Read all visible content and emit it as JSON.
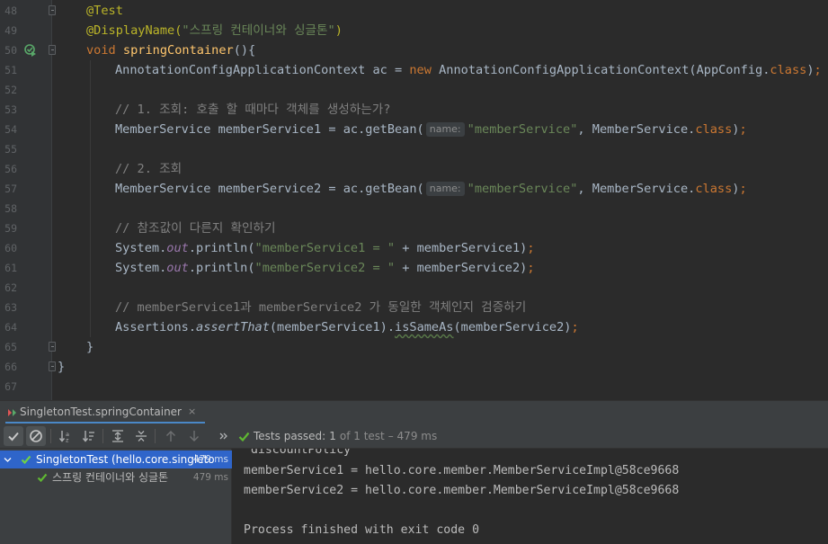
{
  "editor": {
    "lines": [
      {
        "n": "48",
        "tokens": [
          {
            "t": "@Test",
            "c": "ann"
          }
        ]
      },
      {
        "n": "49",
        "tokens": [
          {
            "t": "@DisplayName(",
            "c": "ann"
          },
          {
            "t": "\"스프링 컨테이너와 싱글톤\"",
            "c": "str"
          },
          {
            "t": ")",
            "c": "ann"
          }
        ]
      },
      {
        "n": "50",
        "tokens": [
          {
            "t": "void ",
            "c": "kw"
          },
          {
            "t": "springContainer",
            "c": "fn"
          },
          {
            "t": "(){",
            "c": ""
          }
        ]
      },
      {
        "n": "51",
        "tokens": [
          {
            "t": "AnnotationConfigApplicationContext ac = ",
            "c": ""
          },
          {
            "t": "new ",
            "c": "kw"
          },
          {
            "t": "AnnotationConfigApplicationContext(AppConfig.",
            "c": ""
          },
          {
            "t": "class",
            "c": "kw"
          },
          {
            "t": ")",
            "c": ""
          },
          {
            "t": ";",
            "c": "kw"
          }
        ]
      },
      {
        "n": "52",
        "tokens": []
      },
      {
        "n": "53",
        "tokens": [
          {
            "t": "// 1. 조회: 호출 할 때마다 객체를 생성하는가?",
            "c": "cmt"
          }
        ]
      },
      {
        "n": "54",
        "tokens": [
          {
            "t": "MemberService memberService1 = ac.getBean(",
            "c": ""
          },
          {
            "t": "name:",
            "c": "hint"
          },
          {
            "t": "\"memberService\"",
            "c": "str"
          },
          {
            "t": ", MemberService.",
            "c": ""
          },
          {
            "t": "class",
            "c": "kw"
          },
          {
            "t": ")",
            "c": ""
          },
          {
            "t": ";",
            "c": "kw"
          }
        ]
      },
      {
        "n": "55",
        "tokens": []
      },
      {
        "n": "56",
        "tokens": [
          {
            "t": "// 2. 조회",
            "c": "cmt"
          }
        ]
      },
      {
        "n": "57",
        "tokens": [
          {
            "t": "MemberService memberService2 = ac.getBean(",
            "c": ""
          },
          {
            "t": "name:",
            "c": "hint"
          },
          {
            "t": "\"memberService\"",
            "c": "str"
          },
          {
            "t": ", MemberService.",
            "c": ""
          },
          {
            "t": "class",
            "c": "kw"
          },
          {
            "t": ")",
            "c": ""
          },
          {
            "t": ";",
            "c": "kw"
          }
        ]
      },
      {
        "n": "58",
        "tokens": []
      },
      {
        "n": "59",
        "tokens": [
          {
            "t": "// 참조값이 다른지 확인하기",
            "c": "cmt"
          }
        ]
      },
      {
        "n": "60",
        "tokens": [
          {
            "t": "System.",
            "c": ""
          },
          {
            "t": "out",
            "c": "fld"
          },
          {
            "t": ".println(",
            "c": ""
          },
          {
            "t": "\"memberService1 = \"",
            "c": "str"
          },
          {
            "t": " + memberService1)",
            "c": ""
          },
          {
            "t": ";",
            "c": "kw"
          }
        ]
      },
      {
        "n": "61",
        "tokens": [
          {
            "t": "System.",
            "c": ""
          },
          {
            "t": "out",
            "c": "fld"
          },
          {
            "t": ".println(",
            "c": ""
          },
          {
            "t": "\"memberService2 = \"",
            "c": "str"
          },
          {
            "t": " + memberService2)",
            "c": ""
          },
          {
            "t": ";",
            "c": "kw"
          }
        ]
      },
      {
        "n": "62",
        "tokens": []
      },
      {
        "n": "63",
        "tokens": [
          {
            "t": "// memberService1과 memberService2 가 동일한 객체인지 검증하기",
            "c": "cmt"
          }
        ]
      },
      {
        "n": "64",
        "tokens": [
          {
            "t": "Assertions.",
            "c": ""
          },
          {
            "t": "assertThat",
            "c": "ital"
          },
          {
            "t": "(memberService1).",
            "c": ""
          },
          {
            "t": "isSameAs",
            "c": "wavy"
          },
          {
            "t": "(memberService2)",
            "c": ""
          },
          {
            "t": ";",
            "c": "kw"
          }
        ]
      },
      {
        "n": "65",
        "tokens": [
          {
            "t": "}",
            "c": ""
          }
        ]
      },
      {
        "n": "66",
        "tokens": [
          {
            "t": "}",
            "c": ""
          }
        ]
      },
      {
        "n": "67",
        "tokens": []
      }
    ]
  },
  "run_tab": {
    "label": "SingletonTest.springContainer",
    "close": "×"
  },
  "status": {
    "prefix": "Tests passed:",
    "passed": "1",
    "of": "of 1 test",
    "duration": "– 479 ms"
  },
  "tree": {
    "root": {
      "name": "SingletonTest (hello.core.singleto",
      "duration": "479 ms"
    },
    "child": {
      "name": "스프링 컨테이너와 싱글톤",
      "duration": "479 ms"
    }
  },
  "console": {
    "lines": [
      "'discountPolicy'",
      "memberService1 = hello.core.member.MemberServiceImpl@58ce9668",
      "memberService2 = hello.core.member.MemberServiceImpl@58ce9668",
      "",
      "Process finished with exit code 0"
    ]
  },
  "colors": {
    "accent": "#4a88c7",
    "selection": "#2f65ca",
    "pass_green": "#5fb832"
  }
}
